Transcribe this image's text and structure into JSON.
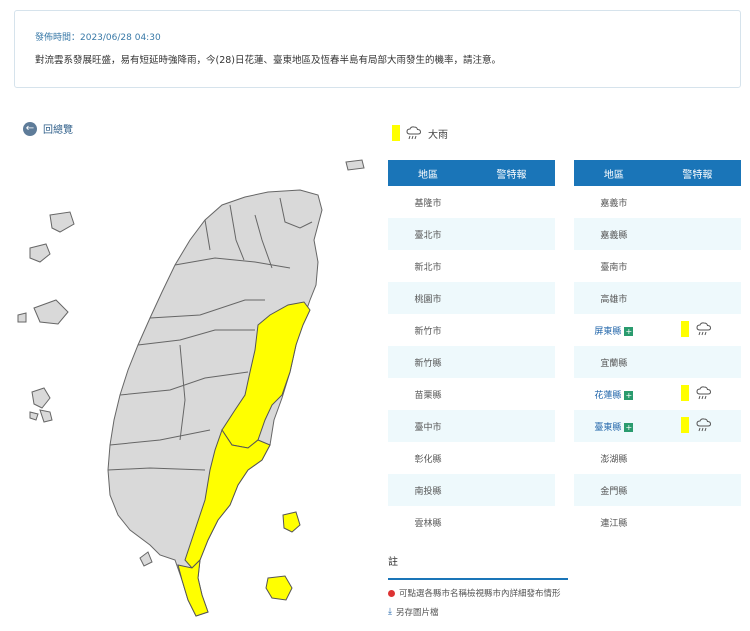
{
  "notice": {
    "time": "發佈時間：2023/06/28 04:30",
    "message": "對流雲系發展旺盛，易有短延時強降雨，今(28)日花蓮、臺東地區及恆春半島有局部大雨發生的機率，請注意。"
  },
  "back_label": "回總覽",
  "legend": {
    "label": "大雨",
    "color": "#ffff00",
    "icon": "rain-cloud-icon"
  },
  "table_left": {
    "headers": [
      "地區",
      "警特報"
    ],
    "rows": [
      {
        "name": "基隆市"
      },
      {
        "name": "臺北市"
      },
      {
        "name": "新北市"
      },
      {
        "name": "桃園市"
      },
      {
        "name": "新竹市"
      },
      {
        "name": "新竹縣"
      },
      {
        "name": "苗栗縣"
      },
      {
        "name": "臺中市"
      },
      {
        "name": "彰化縣"
      },
      {
        "name": "南投縣"
      },
      {
        "name": "雲林縣"
      }
    ]
  },
  "table_right": {
    "headers": [
      "地區",
      "警特報"
    ],
    "rows": [
      {
        "name": "嘉義市"
      },
      {
        "name": "嘉義縣"
      },
      {
        "name": "臺南市"
      },
      {
        "name": "高雄市"
      },
      {
        "name": "屏東縣",
        "warning": true
      },
      {
        "name": "宜蘭縣"
      },
      {
        "name": "花蓮縣",
        "warning": true
      },
      {
        "name": "臺東縣",
        "warning": true
      },
      {
        "name": "澎湖縣"
      },
      {
        "name": "金門縣"
      },
      {
        "name": "連江縣"
      }
    ]
  },
  "notes": {
    "title": "註",
    "item1": "可點選各縣市名稱檢視縣市內詳細發布情形",
    "item2": "另存圖片檔"
  }
}
